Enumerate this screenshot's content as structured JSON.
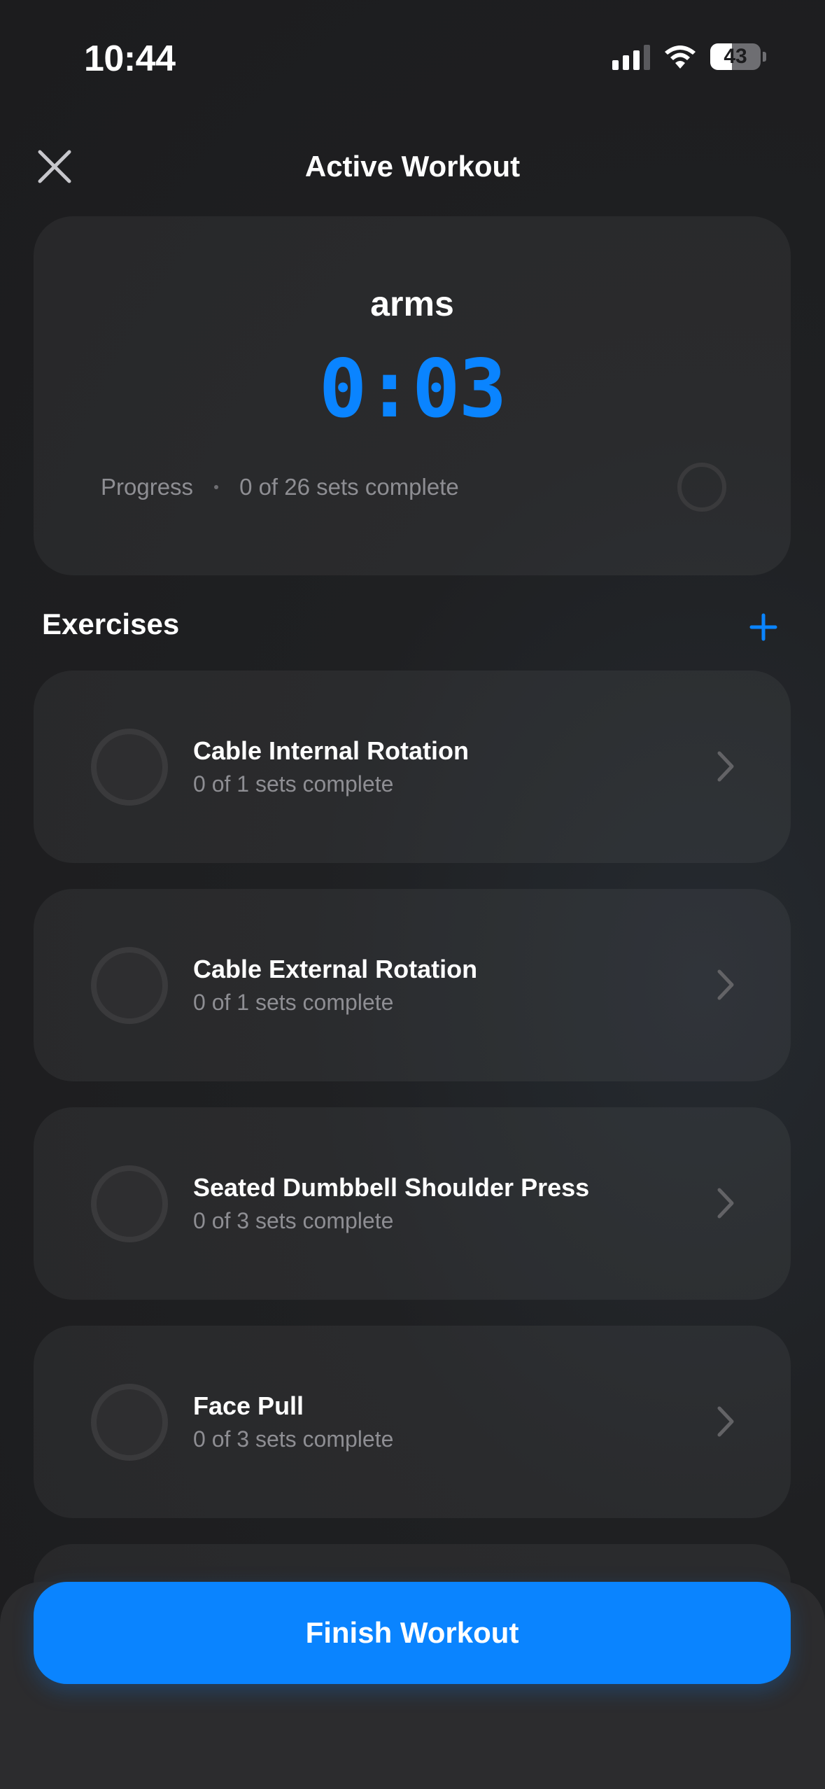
{
  "status_bar": {
    "time": "10:44",
    "battery_level": "43",
    "icons": [
      "cellular-signal-icon",
      "wifi-icon",
      "battery-icon"
    ]
  },
  "header": {
    "title": "Active Workout",
    "close_icon": "close-icon"
  },
  "summary": {
    "workout_name": "arms",
    "timer": "0:03",
    "progress_label": "Progress",
    "progress_text": "0 of 26 sets complete",
    "progress_fraction": 0
  },
  "exercises_section": {
    "title": "Exercises",
    "add_icon": "plus-icon"
  },
  "exercises": [
    {
      "name": "Cable Internal Rotation",
      "status": "0 of 1 sets complete"
    },
    {
      "name": "Cable External Rotation",
      "status": "0 of 1 sets complete"
    },
    {
      "name": "Seated Dumbbell Shoulder Press",
      "status": "0 of 3 sets complete"
    },
    {
      "name": "Face Pull",
      "status": "0 of 3 sets complete"
    }
  ],
  "finish_button": {
    "label": "Finish Workout"
  },
  "colors": {
    "accent": "#0a84ff",
    "background": "#1c1c1e",
    "card": "#2a2a2c",
    "secondary_text": "#8e8e93"
  }
}
